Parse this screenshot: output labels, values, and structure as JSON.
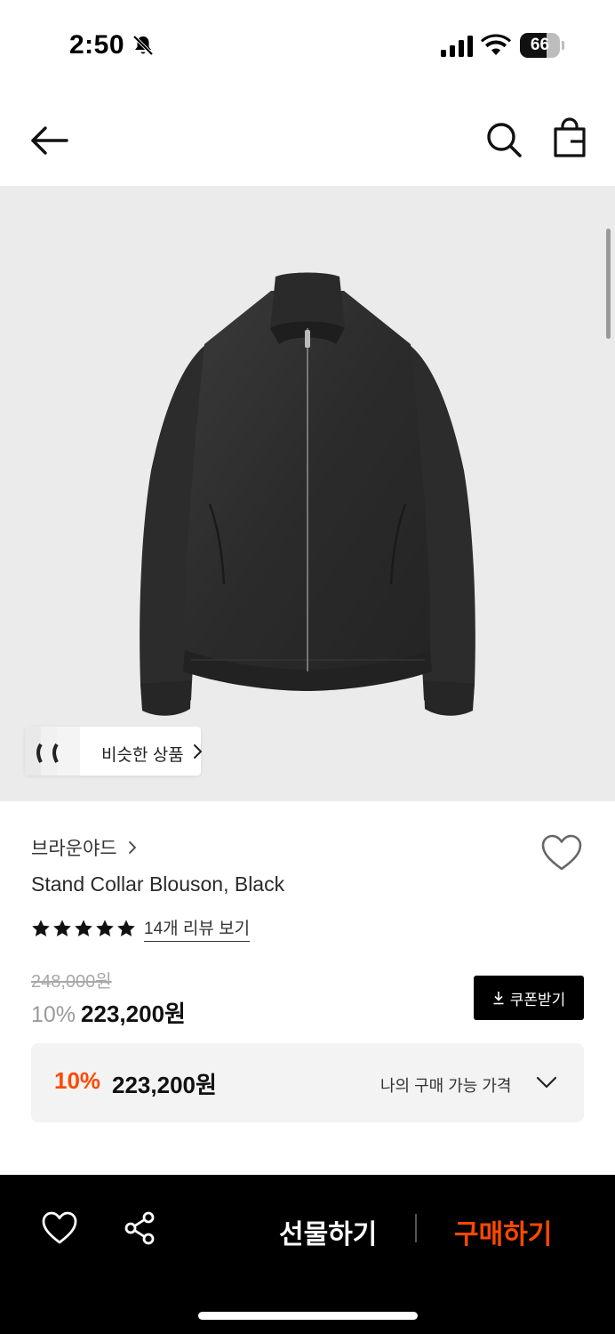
{
  "status_bar": {
    "time": "2:50",
    "battery_level": "66",
    "battery_fraction": 0.66,
    "icons": [
      "bell-slash-icon",
      "signal-icon",
      "wifi-icon",
      "battery-icon"
    ]
  },
  "nav": {
    "icons": [
      "back-arrow-icon",
      "search-icon",
      "shopping-bag-icon"
    ]
  },
  "product_image": {
    "similar_label": "비슷한 상품"
  },
  "product": {
    "brand": "브라운야드",
    "name": "Stand Collar Blouson, Black",
    "rating_stars": 5,
    "review_link": "14개 리뷰 보기",
    "original_price": "248,000원",
    "discount": "10%",
    "sale_price": "223,200원",
    "coupon_label": "쿠폰받기"
  },
  "best_price": {
    "discount": "10%",
    "price": "223,200원",
    "label": "나의 구매 가능 가격"
  },
  "bottom_bar": {
    "gift_label": "선물하기",
    "buy_label": "구매하기"
  },
  "colors": {
    "accent": "#ff4800",
    "image_bg": "#ebebeb",
    "bottom_bar_bg": "#000000",
    "price_box_bg": "#f3f3f3"
  }
}
